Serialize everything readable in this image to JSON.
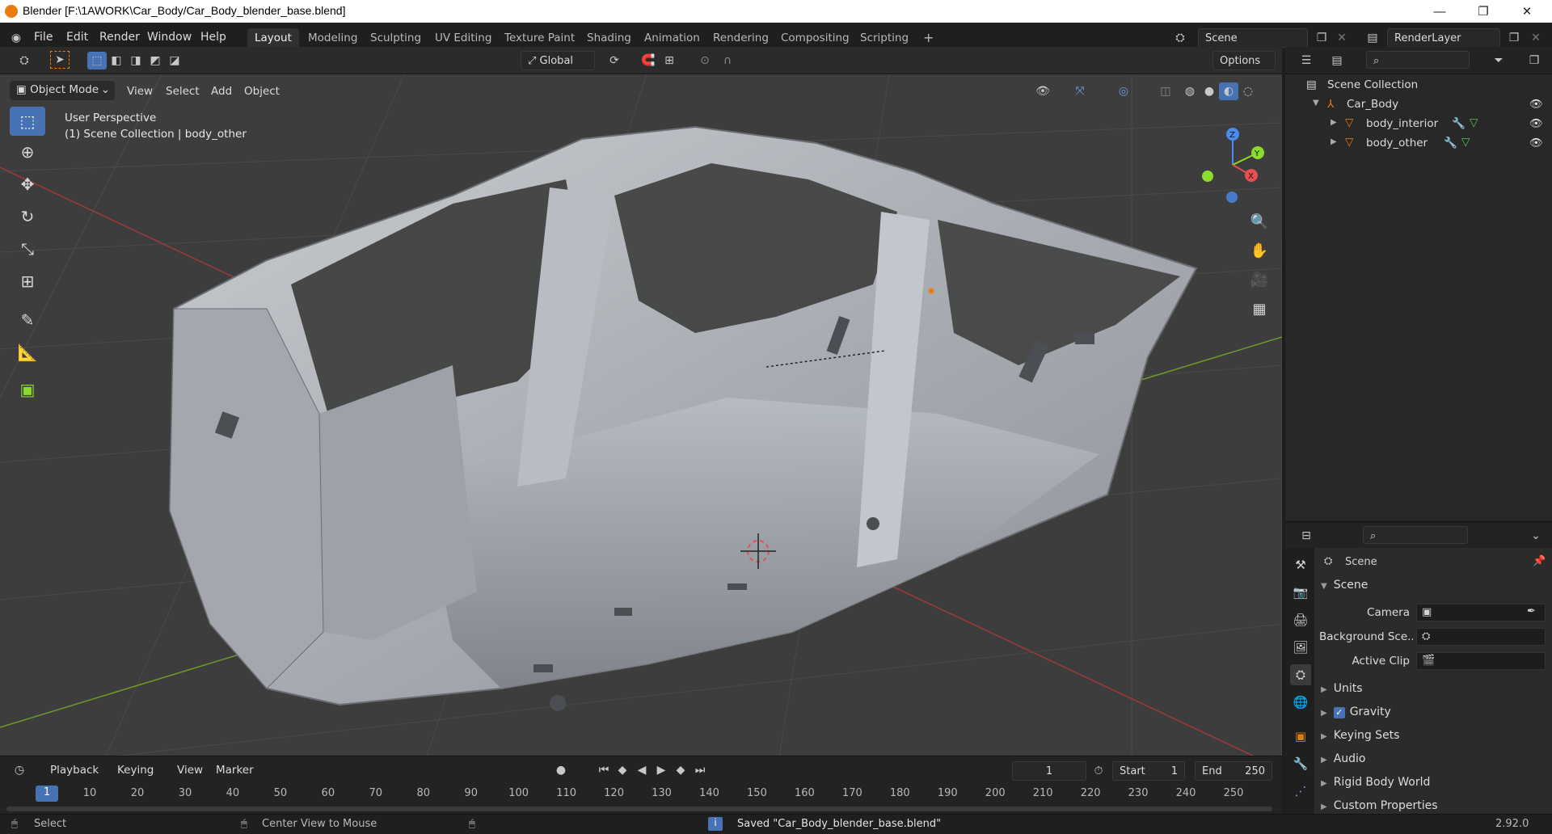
{
  "titlebar": {
    "title": "Blender [F:\\1AWORK\\Car_Body/Car_Body_blender_base.blend]",
    "minimize": "—",
    "restore": "❐",
    "close": "✕"
  },
  "menu": [
    "File",
    "Edit",
    "Render",
    "Window",
    "Help"
  ],
  "workspaces": [
    "Layout",
    "Modeling",
    "Sculpting",
    "UV Editing",
    "Texture Paint",
    "Shading",
    "Animation",
    "Rendering",
    "Compositing",
    "Scripting",
    "+"
  ],
  "active_workspace": "Layout",
  "scene_field": "Scene",
  "renderlayer_field": "RenderLayer",
  "viewport": {
    "mode": "Object Mode",
    "menus": [
      "View",
      "Select",
      "Add",
      "Object"
    ],
    "transform_orientation": "Global",
    "options": "Options",
    "overlay_line1": "User Perspective",
    "overlay_line2": "(1) Scene Collection | body_other",
    "gizmo": {
      "x": "X",
      "y": "Y",
      "z": "Z"
    }
  },
  "timeline": {
    "menus": [
      "Playback",
      "Keying",
      "View",
      "Marker"
    ],
    "current_frame": "1",
    "start_label": "Start",
    "start": "1",
    "end_label": "End",
    "end": "250",
    "ruler": [
      "1",
      "10",
      "20",
      "30",
      "40",
      "50",
      "60",
      "70",
      "80",
      "90",
      "100",
      "110",
      "120",
      "130",
      "140",
      "150",
      "160",
      "170",
      "180",
      "190",
      "200",
      "210",
      "220",
      "230",
      "240",
      "250"
    ]
  },
  "statusbar": {
    "select": "Select",
    "center_view": "Center View to Mouse",
    "message": "Saved \"Car_Body_blender_base.blend\"",
    "version": "2.92.0"
  },
  "outliner": {
    "root": "Scene Collection",
    "items": [
      {
        "name": "Car_Body",
        "level": 1
      },
      {
        "name": "body_interior",
        "level": 2
      },
      {
        "name": "body_other",
        "level": 2
      }
    ]
  },
  "properties": {
    "context": "Scene",
    "panel_title": "Scene",
    "camera_label": "Camera",
    "background_label": "Background Sce...",
    "active_clip_label": "Active Clip",
    "subpanels": [
      "Units",
      "Gravity",
      "Keying Sets",
      "Audio",
      "Rigid Body World",
      "Custom Properties"
    ],
    "gravity_checked": true
  },
  "colors": {
    "accent": "#4772b3",
    "x_axis": "#e84f4f",
    "y_axis": "#8bdc2c",
    "z_axis": "#4a8bf0",
    "orange": "#e87d0d"
  }
}
